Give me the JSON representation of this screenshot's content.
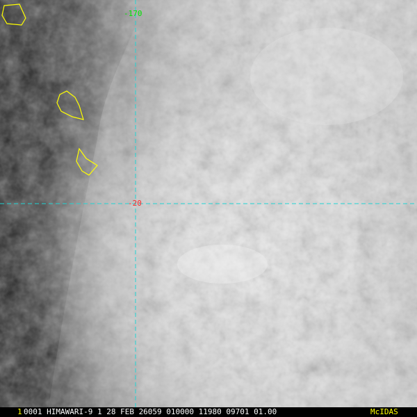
{
  "image": {
    "sensor_line": "0001 HIMAWARI-9  1 28 FEB 26059 010000 11980 09701 01.00",
    "frame_index": "1",
    "brand": "McIDAS",
    "footer_color": "#ffffff",
    "index_color": "#ffff00",
    "brand_color": "#ffff00"
  },
  "grid": {
    "longitude_label": "-170",
    "latitude_label": "-20",
    "line_color": "#22d3d3",
    "lon_label_color": "#00e600",
    "lat_label_color": "#ff2a2a"
  },
  "overlay": {
    "island_outline_color": "#ffff00"
  }
}
